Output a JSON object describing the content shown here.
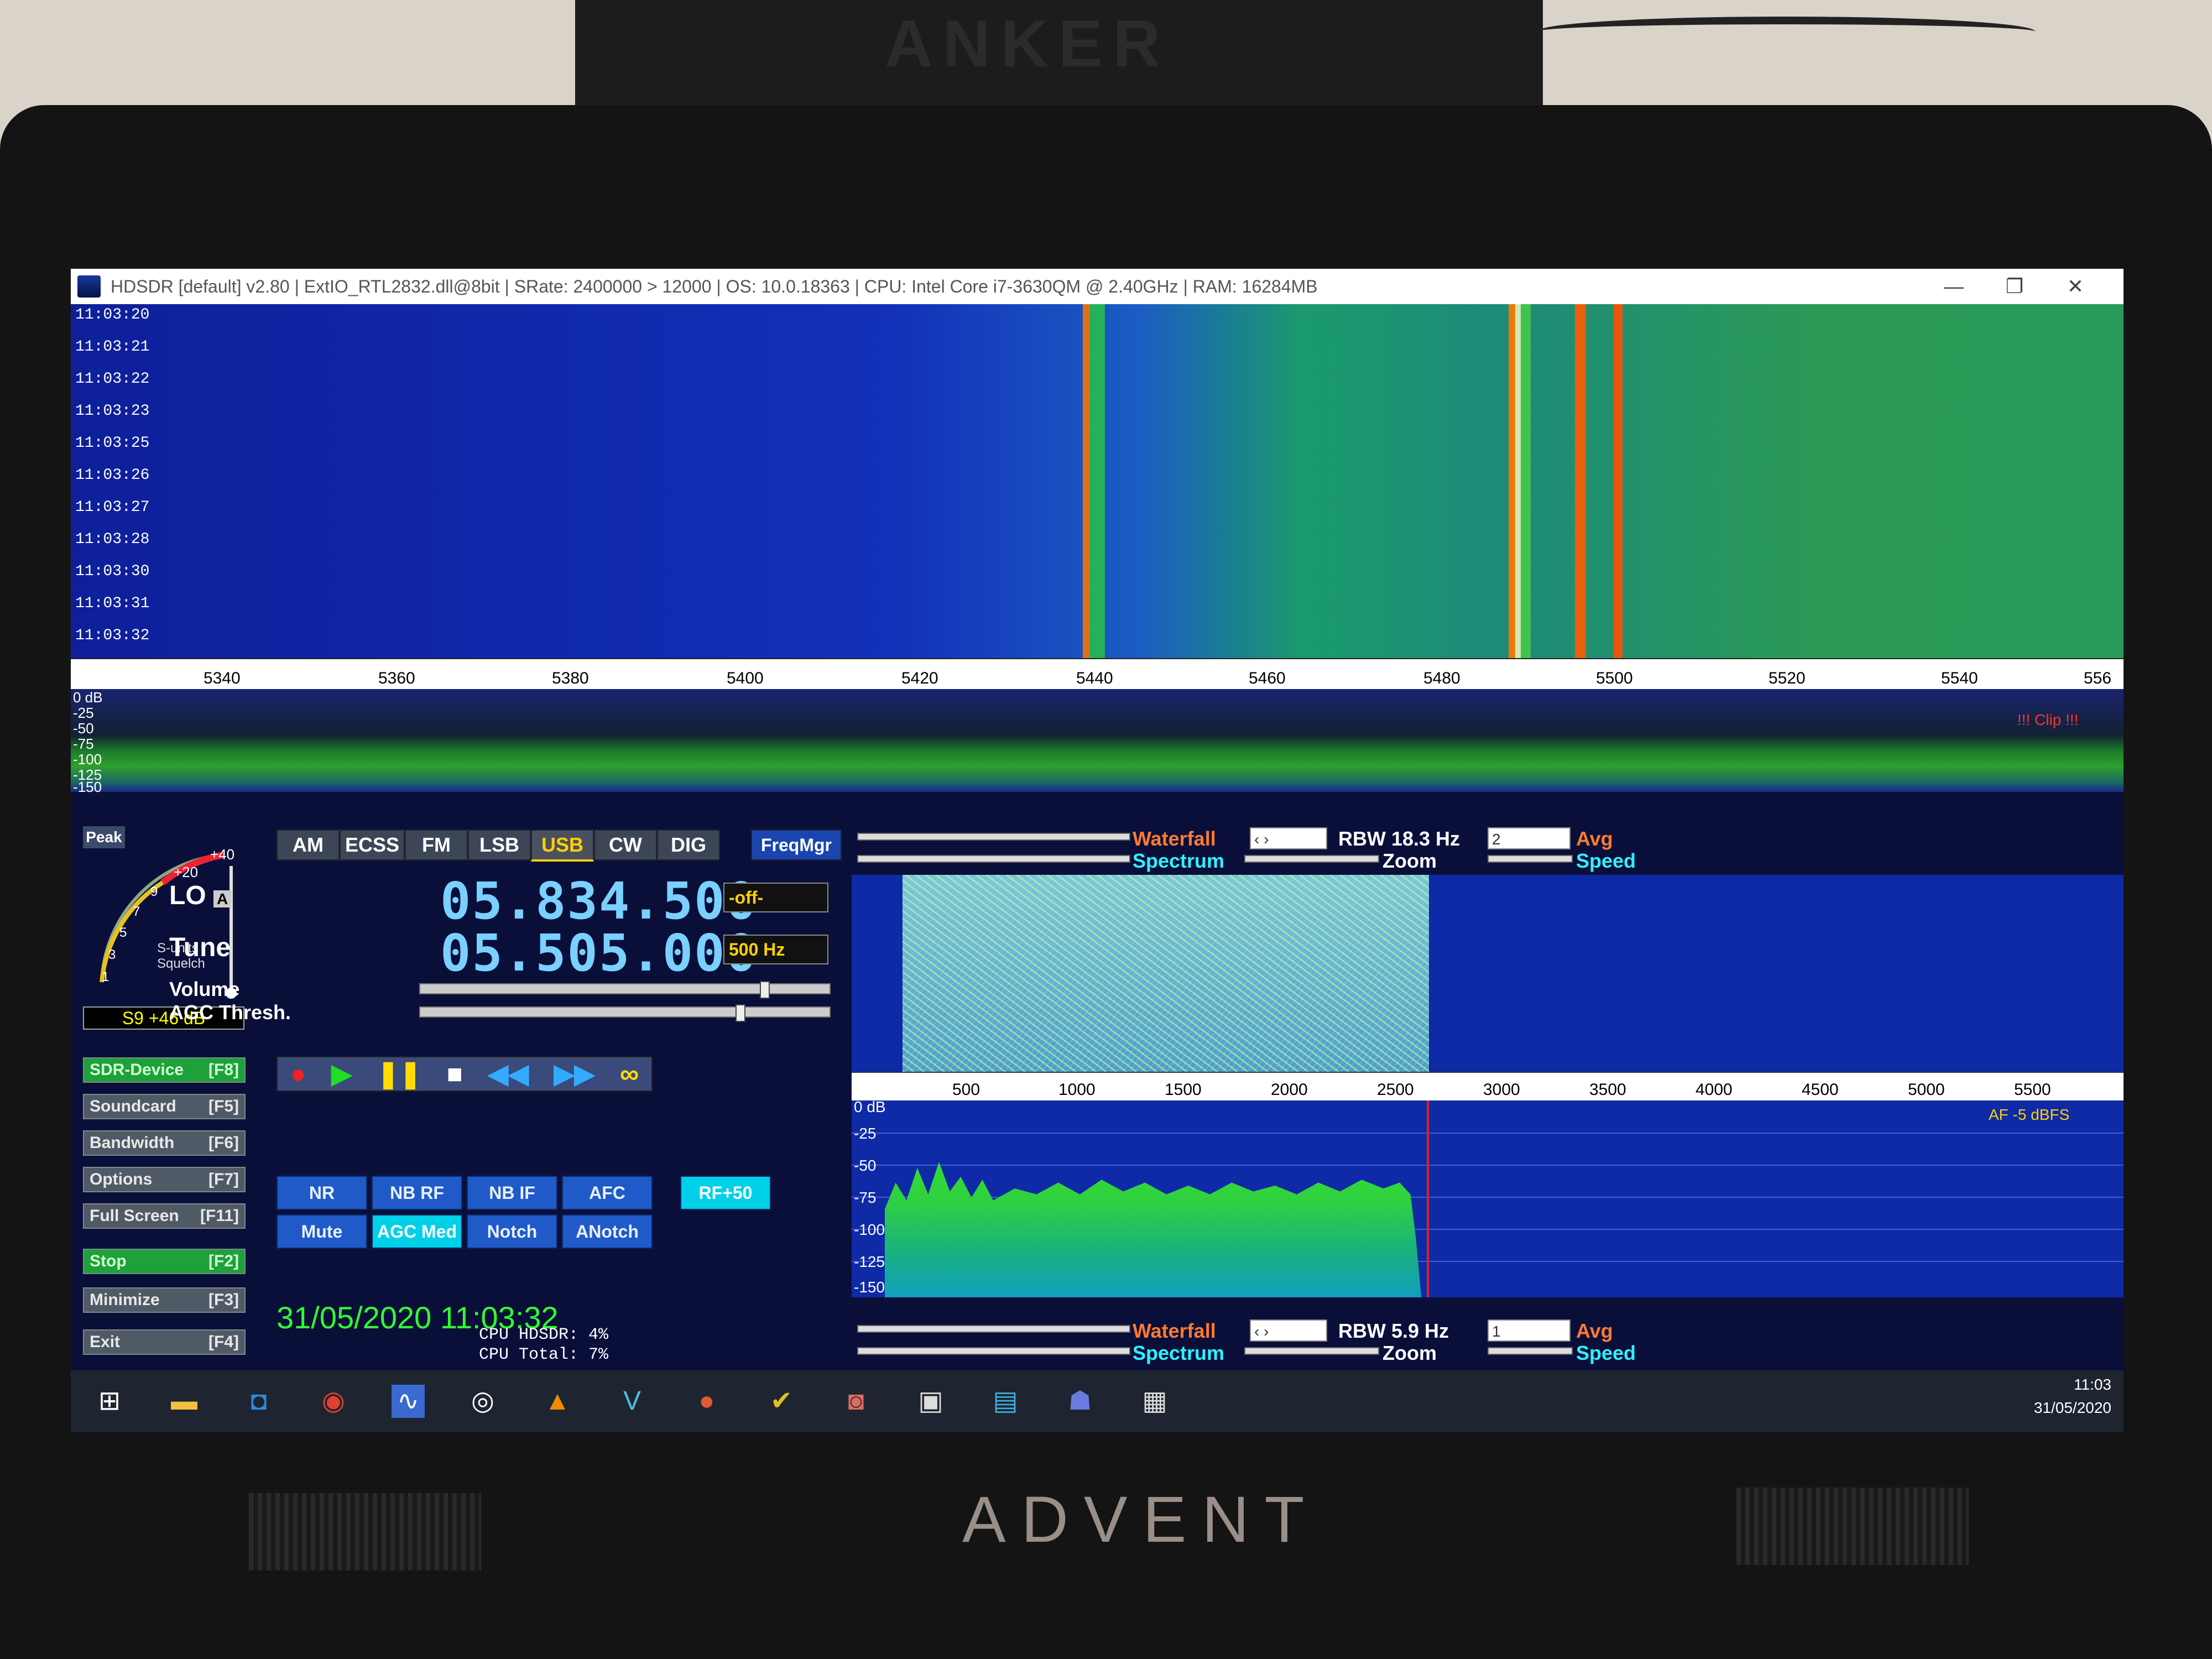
{
  "photo": {
    "box_brand": "ANKER",
    "monitor_brand": "ADVENT"
  },
  "window": {
    "title": "HDSDR  [default]  v2.80   |  ExtIO_RTL2832.dll@8bit  |  SRate: 2400000 > 12000  |  OS: 10.0.18363  |  CPU: Intel Core i7-3630QM @ 2.40GHz  |  RAM: 16284MB",
    "minimize": "—",
    "restore": "❐",
    "close": "✕"
  },
  "waterfall": {
    "timestamps": [
      "11:03:20",
      "11:03:21",
      "11:03:22",
      "11:03:23",
      "11:03:25",
      "11:03:26",
      "11:03:27",
      "11:03:28",
      "11:03:30",
      "11:03:31",
      "11:03:32"
    ],
    "freq_ticks": [
      "5340",
      "5360",
      "5380",
      "5400",
      "5420",
      "5440",
      "5460",
      "5480",
      "5500",
      "5520",
      "5540",
      "556"
    ],
    "spectrum_db": [
      "0 dB",
      "-25",
      "-50",
      "-75",
      "-100",
      "-125",
      "-150"
    ],
    "clip": "!!! Clip !!!"
  },
  "left": {
    "peak": "Peak",
    "smeter": {
      "p20": "+20",
      "p40": "+40",
      "nine": "9",
      "seven": "7",
      "five": "5",
      "three": "3",
      "one": "1",
      "units": "S-units",
      "squelch": "Squelch",
      "reading": "S9 +46 dB"
    },
    "buttons": [
      {
        "label": "SDR-Device",
        "key": "[F8]"
      },
      {
        "label": "Soundcard",
        "key": "[F5]"
      },
      {
        "label": "Bandwidth",
        "key": "[F6]"
      },
      {
        "label": "Options",
        "key": "[F7]"
      },
      {
        "label": "Full Screen",
        "key": "[F11]"
      },
      {
        "label": "Stop",
        "key": "[F2]"
      },
      {
        "label": "Minimize",
        "key": "[F3]"
      },
      {
        "label": "Exit",
        "key": "[F4]"
      }
    ]
  },
  "modes": [
    "AM",
    "ECSS",
    "FM",
    "LSB",
    "USB",
    "CW",
    "DIG",
    "FreqMgr"
  ],
  "tuning": {
    "lo_label": "LO",
    "lo_sub": "A",
    "lo_freq": "05.834.500",
    "lo_select": "-off-",
    "tune_label": "Tune",
    "tune_freq": "05.505.000",
    "tune_select": "500 Hz",
    "volume_label": "Volume",
    "agc_label": "AGC Thresh."
  },
  "transport": {
    "record": "●",
    "play": "▶",
    "pause": "❚❚",
    "stop": "■",
    "rew": "◀◀",
    "ff": "▶▶",
    "loop": "∞"
  },
  "dsp": {
    "nr": "NR",
    "nb_rf": "NB RF",
    "nb_if": "NB IF",
    "afc": "AFC",
    "rf50": "RF+50",
    "mute": "Mute",
    "agc": "AGC Med",
    "notch": "Notch",
    "anotch": "ANotch"
  },
  "status": {
    "datetime": "31/05/2020 11:03:32",
    "cpu_hdsdr": "CPU HDSDR:  4%",
    "cpu_total": "CPU Total:  7%"
  },
  "rf_controls": {
    "waterfall": "Waterfall",
    "spectrum": "Spectrum",
    "rbw": "RBW 18.3 Hz",
    "zoom": "Zoom",
    "avg_value": "2",
    "avg": "Avg",
    "speed": "Speed",
    "arrows": "‹   ›"
  },
  "af_controls": {
    "waterfall": "Waterfall",
    "spectrum": "Spectrum",
    "rbw": "RBW  5.9 Hz",
    "zoom": "Zoom",
    "avg_value": "1",
    "avg": "Avg",
    "speed": "Speed",
    "arrows": "‹   ›"
  },
  "af": {
    "ticks": [
      "500",
      "1000",
      "1500",
      "2000",
      "2500",
      "3000",
      "3500",
      "4000",
      "4500",
      "5000",
      "5500"
    ],
    "db": [
      "0 dB",
      "-25",
      "-50",
      "-75",
      "-100",
      "-125",
      "-150"
    ],
    "dbfs": "AF  -5 dBFS"
  },
  "taskbar": {
    "icons": [
      "windows-icon",
      "folder-icon",
      "outlook-icon",
      "chrome-icon",
      "hdsdr-icon",
      "media-icon",
      "vlc-icon",
      "v-icon",
      "app-icon",
      "check-icon",
      "app2-icon",
      "vnc-icon",
      "ve-icon",
      "teams-icon",
      "screen-icon"
    ],
    "time": "11:03",
    "date": "31/05/2020"
  }
}
